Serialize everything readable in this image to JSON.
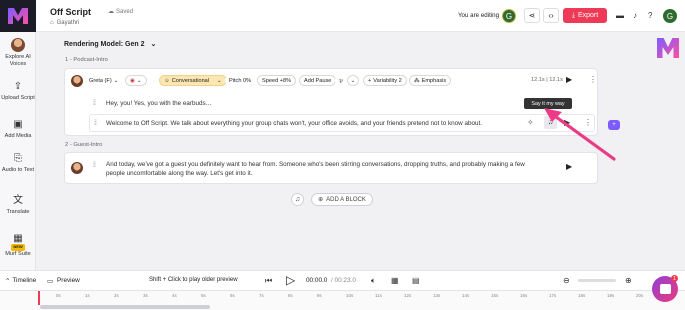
{
  "project": {
    "title": "Off Script",
    "saved_label": "Saved",
    "breadcrumb": "Gayathri"
  },
  "header": {
    "editing_label": "You are editing",
    "user_initial": "G",
    "export_label": "Export"
  },
  "sidebar": {
    "items": [
      {
        "label": "Explore AI Voices",
        "icon": "voice-avatar-icon"
      },
      {
        "label": "Upload Script",
        "icon": "upload-icon"
      },
      {
        "label": "Add Media",
        "icon": "media-icon"
      },
      {
        "label": "Audio to Text",
        "icon": "transcribe-icon"
      },
      {
        "label": "Translate",
        "icon": "translate-icon"
      },
      {
        "label": "Murf Suite",
        "icon": "grid-icon",
        "badge": "NEW"
      }
    ]
  },
  "editor": {
    "rendering_model": "Rendering Model: Gen 2",
    "section1": {
      "label": "1 -  Podcast-Intro"
    },
    "voice": {
      "name": "Greta (F)",
      "style": "Conversational",
      "pitch": "Pitch 0%",
      "speed": "Speed +8%",
      "add_pause": "Add Pause",
      "variability": "Variability 2",
      "emphasis": "Emphasis",
      "duration": "12.1s | 12.1s"
    },
    "lines": [
      "Hey, you! Yes, you with the earbuds…",
      "Welcome to Off Script. We talk about everything your group chats won't, your office avoids, and your friends pretend not to know about."
    ],
    "tooltip": "Say it my way",
    "section2": {
      "label": "2 -  Guest-Intro"
    },
    "section2_text": "And today, we've got a guest you definitely want to hear from. Someone who's been stirring conversations, dropping truths, and probably making a few people uncomfortable along the way. Let's get into it.",
    "add_block_label": "ADD A BLOCK"
  },
  "footer": {
    "timeline_label": "Timeline",
    "preview_label": "Preview",
    "hint": "Shift + Click to play older preview",
    "time_current": "00:00.0",
    "time_total": "/ 00:23.0",
    "ruler_ticks": [
      "0s",
      "1s",
      "2s",
      "3s",
      "4s",
      "5s",
      "6s",
      "7s",
      "8s",
      "9s",
      "10s",
      "11s",
      "12s",
      "13s",
      "14s",
      "15s",
      "16s",
      "17s",
      "18s",
      "19s",
      "20s",
      "21s"
    ],
    "chat_badge": "1"
  },
  "colors": {
    "accent": "#ee3a56",
    "style_pill": "#fde7b0",
    "arrow": "#ec3a86"
  }
}
